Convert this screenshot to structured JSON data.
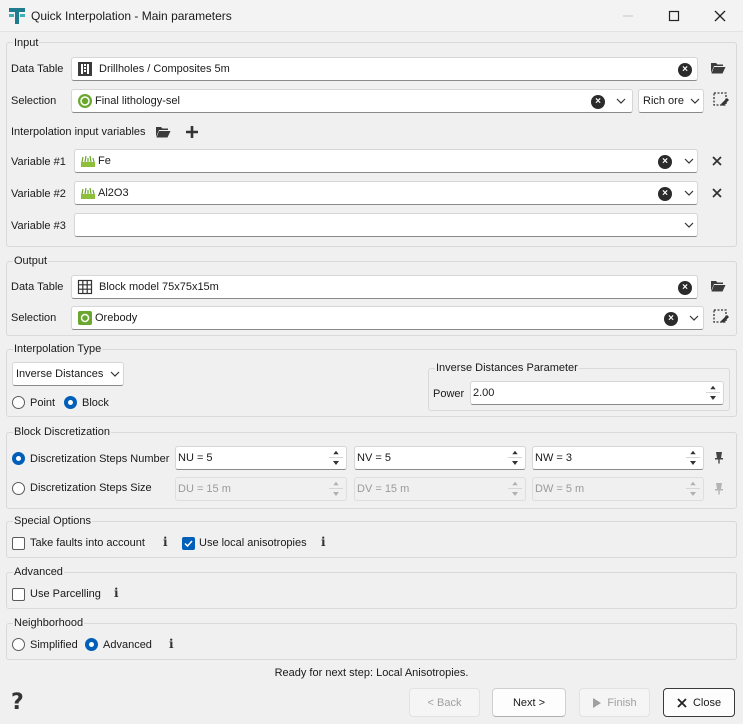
{
  "window": {
    "title": "Quick Interpolation - Main parameters"
  },
  "input": {
    "group_title": "Input",
    "data_table_label": "Data Table",
    "data_table_value": "Drillholes / Composites 5m",
    "selection_label": "Selection",
    "selection_value": "Final lithology-sel",
    "selection_filter_value": "Rich ore",
    "variables_label": "Interpolation input variables",
    "variables": [
      {
        "label": "Variable #1",
        "value": "Fe"
      },
      {
        "label": "Variable #2",
        "value": "Al2O3"
      },
      {
        "label": "Variable #3",
        "value": ""
      }
    ]
  },
  "output": {
    "group_title": "Output",
    "data_table_label": "Data Table",
    "data_table_value": "Block model 75x75x15m",
    "selection_label": "Selection",
    "selection_value": "Orebody"
  },
  "interpolation_type": {
    "group_title": "Interpolation Type",
    "method_value": "Inverse Distances",
    "point_label": "Point",
    "block_label": "Block",
    "block_selected": true,
    "params_title": "Inverse Distances Parameter",
    "power_label": "Power",
    "power_value": "2.00"
  },
  "block_discretization": {
    "group_title": "Block Discretization",
    "steps_number_label": "Discretization Steps Number",
    "steps_size_label": "Discretization Steps Size",
    "nu": "NU = 5",
    "nv": "NV = 5",
    "nw": "NW = 3",
    "du": "DU = 15 m",
    "dv": "DV = 15 m",
    "dw": "DW = 5 m"
  },
  "special_options": {
    "group_title": "Special Options",
    "faults_label": "Take faults into account",
    "faults_checked": false,
    "anisotropies_label": "Use local anisotropies",
    "anisotropies_checked": true
  },
  "advanced": {
    "group_title": "Advanced",
    "parcelling_label": "Use Parcelling",
    "parcelling_checked": false
  },
  "neighborhood": {
    "group_title": "Neighborhood",
    "simplified_label": "Simplified",
    "advanced_label": "Advanced",
    "advanced_selected": true
  },
  "footer": {
    "status_text": "Ready for next step: Local Anisotropies.",
    "back_label": "< Back",
    "next_label": "Next >",
    "finish_label": "Finish",
    "close_label": "Close"
  },
  "colors": {
    "accent": "#005fb8",
    "selection_icon_green": "#6aa82d",
    "variable_icon_green": "#8fbf3a"
  }
}
